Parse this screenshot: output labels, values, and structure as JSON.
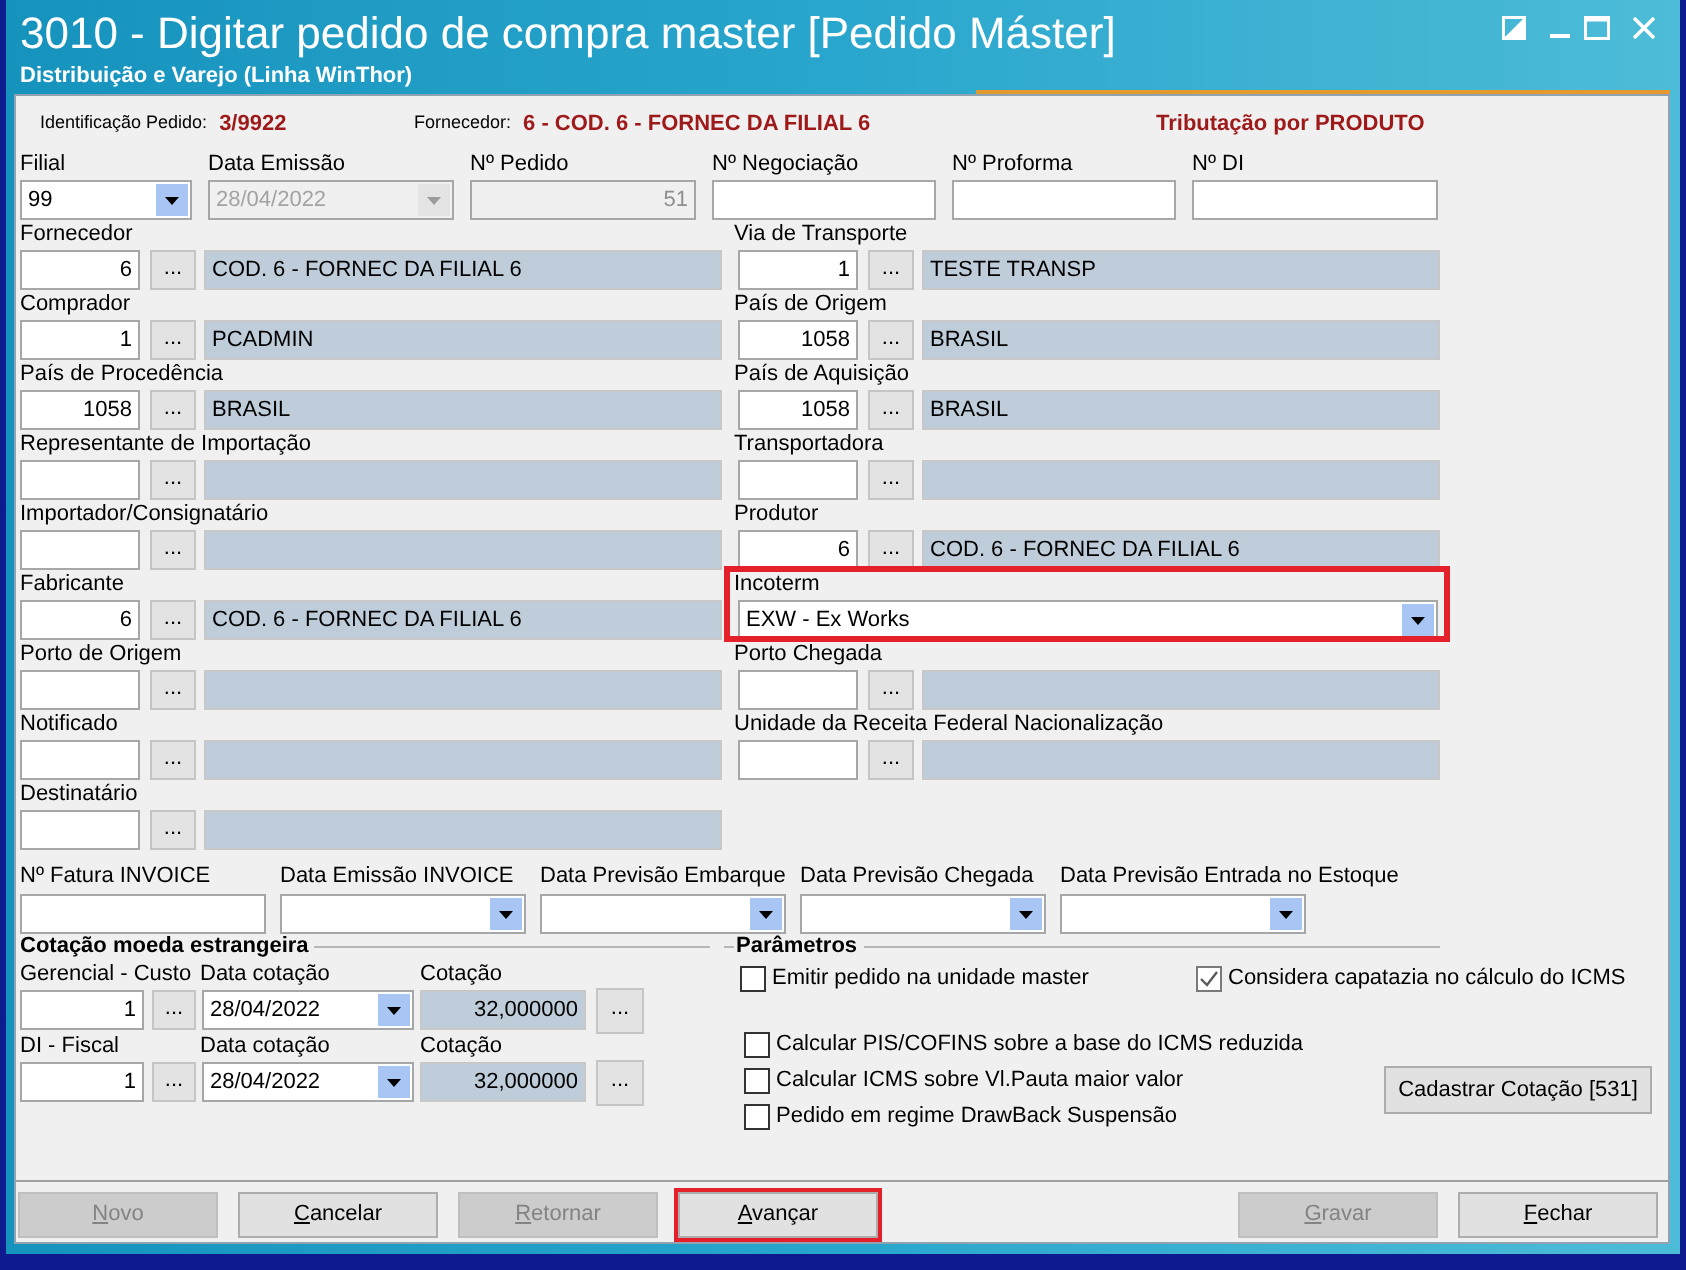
{
  "window": {
    "title": "3010 - Digitar pedido de compra master [Pedido Máster]",
    "subtitle": "Distribuição e Varejo (Linha WinThor)"
  },
  "header": {
    "items": [
      {
        "label": "Identificação Pedido:",
        "value": "3/9922"
      },
      {
        "label": "Fornecedor:",
        "value": "6 - COD. 6 - FORNEC DA FILIAL 6"
      }
    ],
    "taxation": "Tributação por PRODUTO"
  },
  "top_fields": [
    {
      "label": "Filial",
      "kind": "combo",
      "value": "99",
      "disabled": false
    },
    {
      "label": "Data Emissão",
      "kind": "combo",
      "value": "28/04/2022",
      "disabled": true
    },
    {
      "label": "Nº Pedido",
      "kind": "number",
      "value": "51",
      "disabled": true
    },
    {
      "label": "Nº Negociação",
      "kind": "text",
      "disabled": false
    },
    {
      "label": "Nº Proforma",
      "kind": "text",
      "disabled": false
    },
    {
      "label": "Nº DI",
      "kind": "text",
      "disabled": false
    }
  ],
  "lookups_left": [
    {
      "label": "Fornecedor",
      "kind": "lookup",
      "code": "6",
      "button": "...",
      "description": "COD. 6 - FORNEC DA FILIAL 6"
    },
    {
      "label": "Comprador",
      "kind": "lookup",
      "code": "1",
      "button": "...",
      "description": "PCADMIN"
    },
    {
      "label": "País de Procedência",
      "kind": "lookup",
      "code": "1058",
      "button": "...",
      "description": "BRASIL"
    },
    {
      "label": "Representante de Importação",
      "kind": "lookup",
      "button": "..."
    },
    {
      "label": "Importador/Consignatário",
      "kind": "lookup",
      "button": "..."
    },
    {
      "label": "Fabricante",
      "kind": "lookup",
      "code": "6",
      "button": "...",
      "description": "COD. 6 - FORNEC DA FILIAL 6"
    },
    {
      "label": "Porto de Origem",
      "kind": "lookup",
      "button": "..."
    },
    {
      "label": "Notificado",
      "kind": "lookup",
      "button": "..."
    },
    {
      "label": "Destinatário",
      "kind": "lookup",
      "button": "..."
    }
  ],
  "lookups_right": [
    {
      "label": "Via de Transporte",
      "kind": "lookup",
      "code": "1",
      "button": "...",
      "description": "TESTE TRANSP"
    },
    {
      "label": "País de Origem",
      "kind": "lookup",
      "code": "1058",
      "button": "...",
      "description": "BRASIL"
    },
    {
      "label": "País de Aquisição",
      "kind": "lookup",
      "code": "1058",
      "button": "...",
      "description": "BRASIL"
    },
    {
      "label": "Transportadora",
      "kind": "lookup",
      "button": "..."
    },
    {
      "label": "Produtor",
      "kind": "lookup",
      "code": "6",
      "button": "...",
      "description": "COD. 6 - FORNEC DA FILIAL 6"
    },
    {
      "label": "Incoterm",
      "kind": "combo",
      "value": "EXW - Ex Works",
      "highlighted": true
    },
    {
      "label": "Porto Chegada",
      "kind": "lookup",
      "button": "..."
    },
    {
      "label": "Unidade da Receita Federal Nacionalização",
      "kind": "lookup",
      "button": "..."
    }
  ],
  "invoice_fields": [
    {
      "label": "Nº Fatura INVOICE",
      "kind": "text"
    },
    {
      "label": "Data Emissão INVOICE",
      "kind": "combo"
    },
    {
      "label": "Data Previsão Embarque",
      "kind": "combo"
    },
    {
      "label": "Data Previsão Chegada",
      "kind": "combo"
    },
    {
      "label": "Data Previsão Entrada no Estoque",
      "kind": "combo"
    }
  ],
  "quotes": {
    "title": "Cotação moeda estrangeira",
    "rows": [
      {
        "label": "Gerencial - Custo",
        "code": "1",
        "button": "...",
        "date_label": "Data cotação",
        "date": "28/04/2022",
        "rate_label": "Cotação",
        "rate": "32,000000",
        "rate_button": "..."
      },
      {
        "label": "DI - Fiscal",
        "code": "1",
        "button": "...",
        "date_label": "Data cotação",
        "date": "28/04/2022",
        "rate_label": "Cotação",
        "rate": "32,000000",
        "rate_button": "..."
      }
    ]
  },
  "parameters": {
    "title": "Parâmetros",
    "top_options": [
      {
        "label": "Emitir pedido na unidade master",
        "checked": false
      },
      {
        "label": "Considera capatazia no cálculo do ICMS",
        "checked": true
      }
    ],
    "options": [
      {
        "label": "Calcular PIS/COFINS sobre a base do ICMS reduzida",
        "checked": false
      },
      {
        "label": "Calcular ICMS sobre Vl.Pauta maior valor",
        "checked": false
      },
      {
        "label": "Pedido em regime DrawBack Suspensão",
        "checked": false
      }
    ],
    "button": "Cadastrar Cotação [531]"
  },
  "footer": {
    "left": [
      {
        "label": "Novo",
        "disabled": true
      },
      {
        "label": "Cancelar",
        "disabled": false
      },
      {
        "label": "Retornar",
        "disabled": true
      },
      {
        "label": "Avançar",
        "disabled": false,
        "highlighted": true
      }
    ],
    "right": [
      {
        "label": "Gravar",
        "disabled": true
      },
      {
        "label": "Fechar",
        "disabled": false
      }
    ]
  }
}
